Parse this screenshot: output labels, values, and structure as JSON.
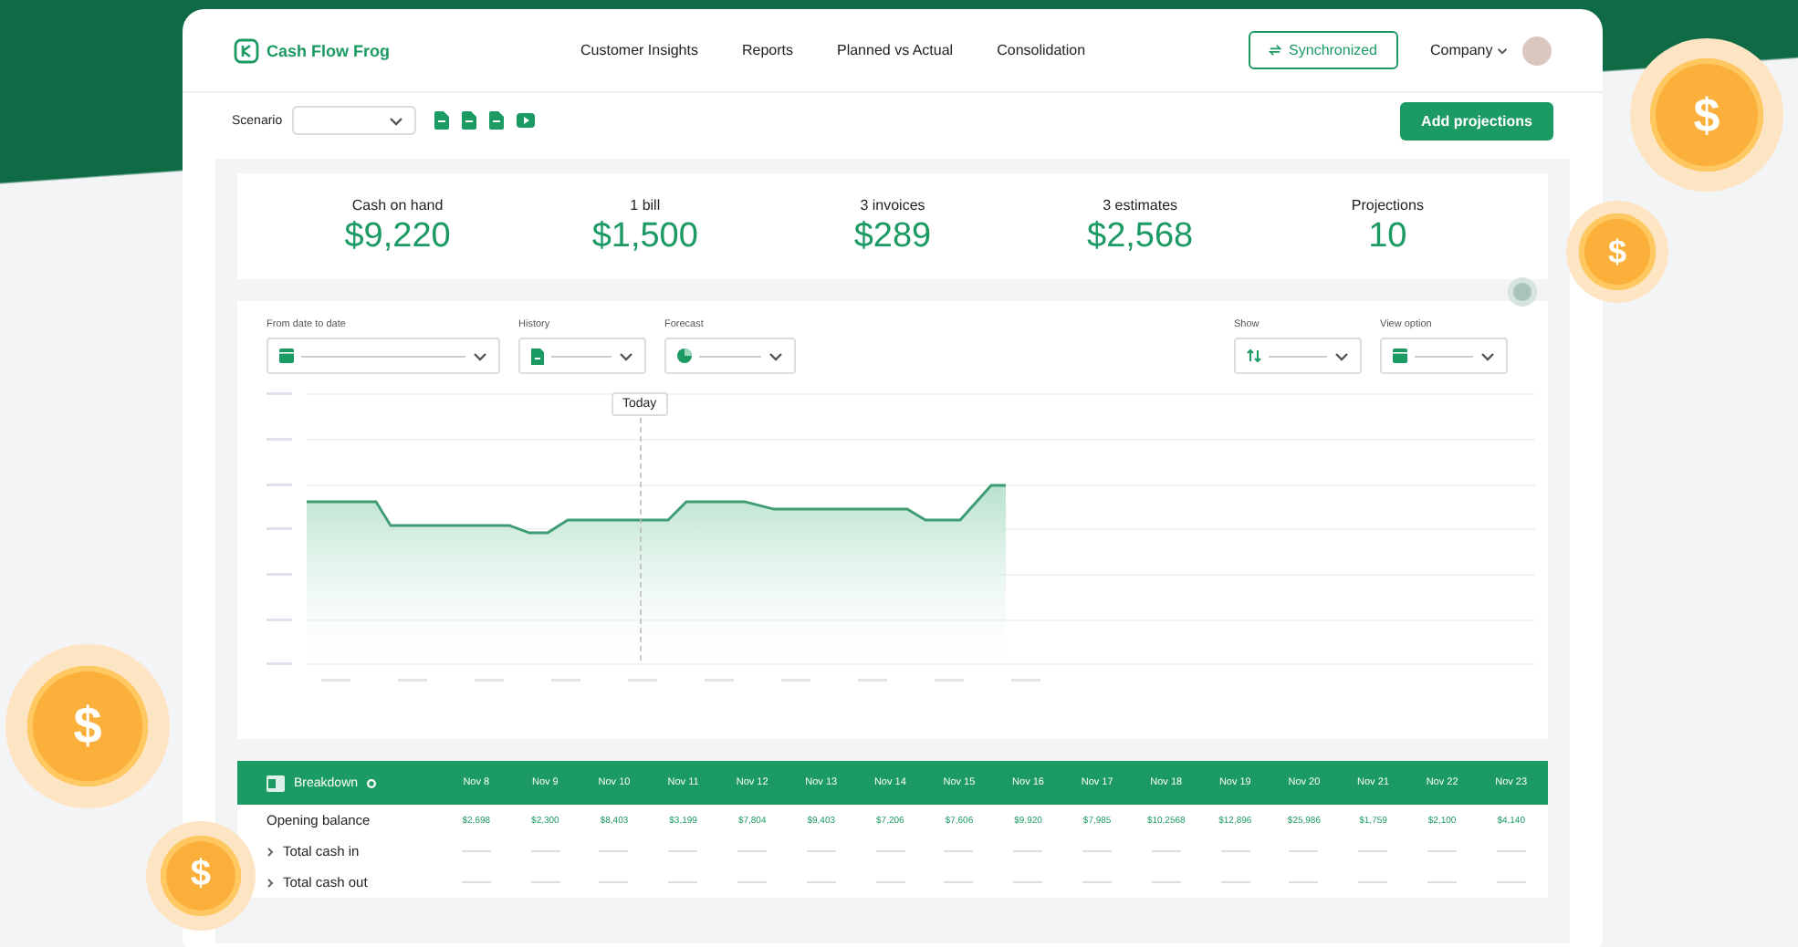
{
  "header": {
    "logo": "Cash Flow Frog",
    "nav": [
      "Customer Insights",
      "Reports",
      "Planned vs Actual",
      "Consolidation"
    ],
    "sync_button": "Synchronized",
    "company_menu": "Company"
  },
  "toolbar": {
    "scenario_label": "Scenario",
    "add_button": "Add projections"
  },
  "stats": [
    {
      "label": "Cash on hand",
      "value": "$9,220"
    },
    {
      "label": "1 bill",
      "value": "$1,500"
    },
    {
      "label": "3 invoices",
      "value": "$289"
    },
    {
      "label": "3 estimates",
      "value": "$2,568"
    },
    {
      "label": "Projections",
      "value": "10"
    }
  ],
  "filters_left": [
    {
      "label": "From date to date"
    },
    {
      "label": "History"
    },
    {
      "label": "Forecast"
    }
  ],
  "filters_right": [
    {
      "label": "Show"
    },
    {
      "label": "View option"
    }
  ],
  "chart": {
    "marker_label": "Today"
  },
  "breakdown": {
    "title": "Breakdown",
    "dates": [
      "Nov 8",
      "Nov 9",
      "Nov 10",
      "Nov 11",
      "Nov 12",
      "Nov 13",
      "Nov 14",
      "Nov 15",
      "Nov 16",
      "Nov 17",
      "Nov 18",
      "Nov 19",
      "Nov 20",
      "Nov 21",
      "Nov 22",
      "Nov 23"
    ],
    "rows": [
      {
        "label": "Opening balance",
        "expandable": false,
        "values": [
          "$2,698",
          "$2,300",
          "$8,403",
          "$3,199",
          "$7,804",
          "$9,403",
          "$7,206",
          "$7,606",
          "$9,920",
          "$7,985",
          "$10,2568",
          "$12,896",
          "$25,986",
          "$1,759",
          "$2,100",
          "$4,140"
        ]
      },
      {
        "label": "Total cash in",
        "expandable": true
      },
      {
        "label": "Total cash out",
        "expandable": true
      }
    ]
  },
  "coins": [
    "$",
    "$",
    "$",
    "$"
  ]
}
